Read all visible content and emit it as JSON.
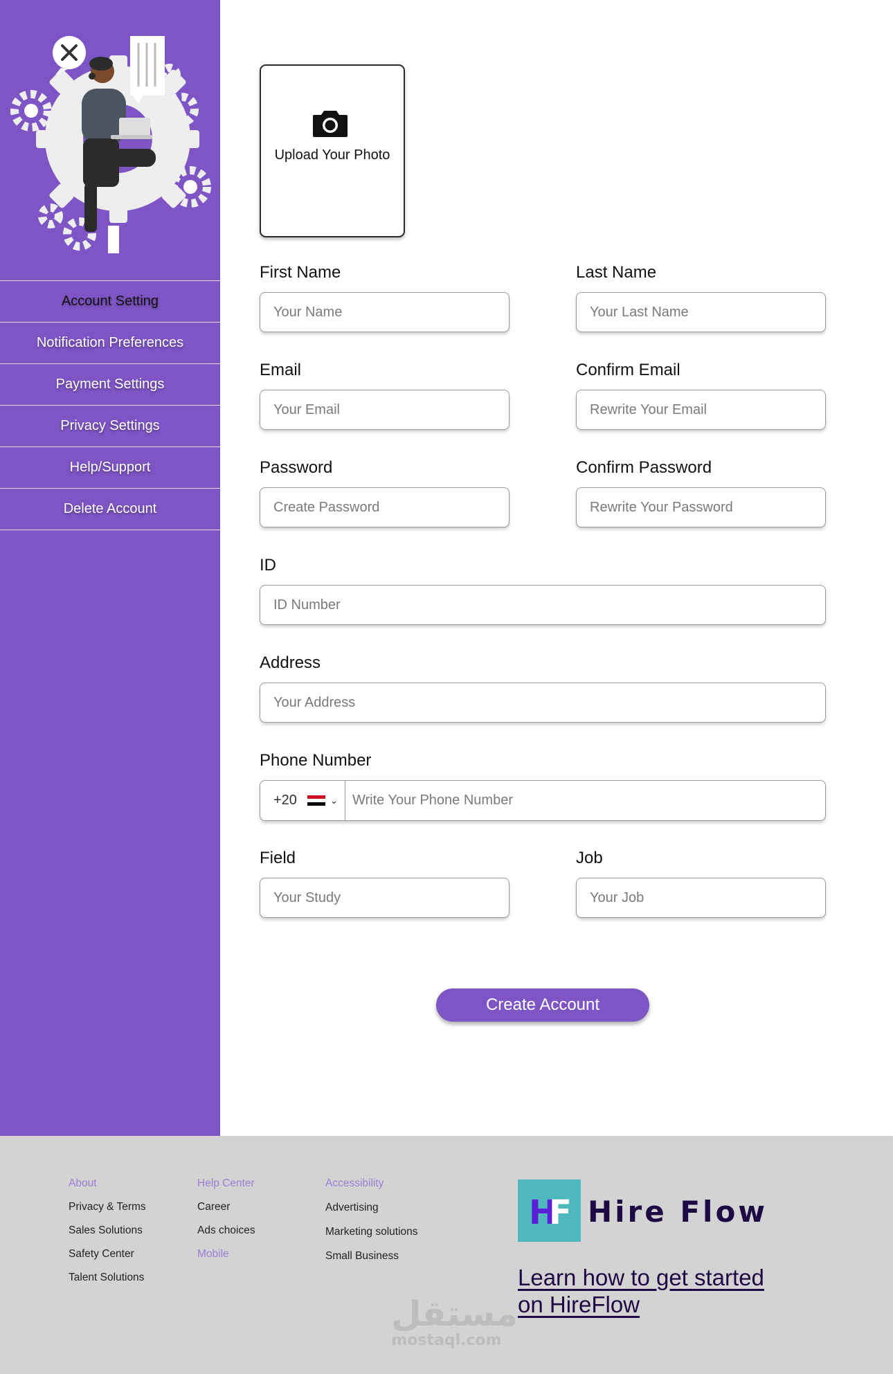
{
  "sidebar": {
    "items": [
      {
        "label": "Account Setting",
        "active": true
      },
      {
        "label": "Notification Preferences",
        "active": false
      },
      {
        "label": "Payment Settings",
        "active": false
      },
      {
        "label": "Privacy Settings",
        "active": false
      },
      {
        "label": "Help/Support",
        "active": false
      },
      {
        "label": "Delete Account",
        "active": false
      }
    ]
  },
  "upload": {
    "label": "Upload Your Photo",
    "icon": "camera-icon"
  },
  "form": {
    "first_name": {
      "label": "First Name",
      "placeholder": "Your Name"
    },
    "last_name": {
      "label": "Last Name",
      "placeholder": "Your Last Name"
    },
    "email": {
      "label": "Email",
      "placeholder": "Your Email"
    },
    "confirm_email": {
      "label": "Confirm Email",
      "placeholder": "Rewrite Your Email"
    },
    "password": {
      "label": "Password",
      "placeholder": "Create Password"
    },
    "confirm_password": {
      "label": "Confirm Password",
      "placeholder": "Rewrite Your Password"
    },
    "id": {
      "label": "ID",
      "placeholder": "ID Number"
    },
    "address": {
      "label": "Address",
      "placeholder": "Your Address"
    },
    "phone": {
      "label": "Phone Number",
      "country_code": "+20",
      "flag": "egypt-flag-icon",
      "placeholder": "Write Your Phone Number"
    },
    "field": {
      "label": "Field",
      "placeholder": "Your Study"
    },
    "job": {
      "label": "Job",
      "placeholder": "Your Job"
    },
    "submit_label": "Create Account"
  },
  "footer": {
    "col1": [
      "About",
      "Privacy & Terms",
      "Sales Solutions",
      "Safety Center",
      "Talent Solutions"
    ],
    "col2": [
      "Help Center",
      "Career",
      "Ads choices",
      "Mobile"
    ],
    "col3": [
      "Accessibility",
      "Advertising",
      "Marketing solutions",
      "Small Business"
    ],
    "logo_letters": {
      "h": "H",
      "f": "F"
    },
    "brand": "Hire Flow",
    "cta": "Learn how to get started on HireFlow",
    "watermark_ar": "مستقل",
    "watermark_en": "mostaql.com"
  },
  "colors": {
    "accent": "#7d55c4",
    "footer_bg": "#d3d3d3",
    "link_purple": "#9b7dd4",
    "logo_bg": "#4fb8bf",
    "brand_text": "#1d0a45"
  }
}
